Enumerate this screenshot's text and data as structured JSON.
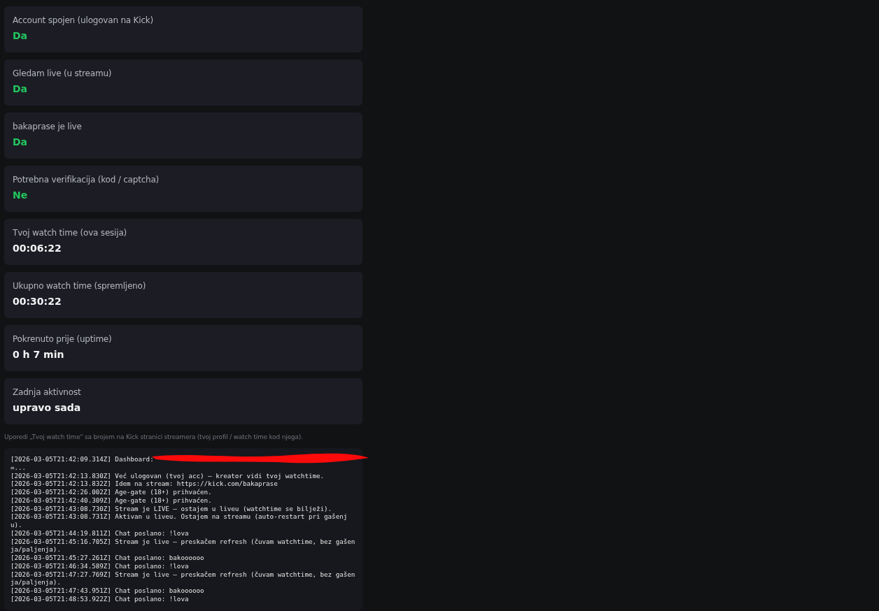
{
  "cards": [
    {
      "label": "Account spojen (ulogovan na Kick)",
      "value": "Da",
      "kind": "status"
    },
    {
      "label": "Gledam live (u streamu)",
      "value": "Da",
      "kind": "status"
    },
    {
      "label": "bakaprase je live",
      "value": "Da",
      "kind": "status"
    },
    {
      "label": "Potrebna verifikacija (kod / captcha)",
      "value": "Ne",
      "kind": "status"
    },
    {
      "label": "Tvoj watch time (ova sesija)",
      "value": "00:06:22",
      "kind": "text"
    },
    {
      "label": "Ukupno watch time (spremljeno)",
      "value": "00:30:22",
      "kind": "text"
    },
    {
      "label": "Pokrenuto prije (uptime)",
      "value": "0 h 7 min",
      "kind": "text"
    },
    {
      "label": "Zadnja aktivnost",
      "value": "upravo sada",
      "kind": "text"
    }
  ],
  "note": "Uporedi „Tvoj watch time\" sa brojem na Kick stranici streamera (tvoj profil / watch time kod njega).",
  "log": [
    {
      "text": "[2026-03-05T21:42:09.314Z] Dashboard:",
      "redacted": true,
      "tail": "=..."
    },
    {
      "text": "[2026-03-05T21:42:13.830Z] Već ulogovan (tvoj acc) – kreator vidi tvoj watchtime."
    },
    {
      "text": "[2026-03-05T21:42:13.832Z] Idem na stream: https://kick.com/bakaprase"
    },
    {
      "text": "[2026-03-05T21:42:26.002Z] Age-gate (18+) prihvaćen."
    },
    {
      "text": "[2026-03-05T21:42:40.309Z] Age-gate (18+) prihvaćen."
    },
    {
      "text": "[2026-03-05T21:43:08.730Z] Stream je LIVE – ostajem u liveu (watchtime se bilježi)."
    },
    {
      "text": "[2026-03-05T21:43:08.731Z] Aktivan u liveu. Ostajem na streamu (auto-restart pri gašenju)."
    },
    {
      "text": "[2026-03-05T21:44:19.811Z] Chat poslano: !lova"
    },
    {
      "text": "[2026-03-05T21:45:16.705Z] Stream je live – preskačem refresh (čuvam watchtime, bez gašenja/paljenja)."
    },
    {
      "text": "[2026-03-05T21:45:27.261Z] Chat poslano: bakoooooo"
    },
    {
      "text": "[2026-03-05T21:46:34.589Z] Chat poslano: !lova"
    },
    {
      "text": "[2026-03-05T21:47:27.769Z] Stream je live – preskačem refresh (čuvam watchtime, bez gašenja/paljenja)."
    },
    {
      "text": "[2026-03-05T21:47:43.951Z] Chat poslano: bakoooooo"
    },
    {
      "text": "[2026-03-05T21:48:53.922Z] Chat poslano: !lova"
    }
  ]
}
